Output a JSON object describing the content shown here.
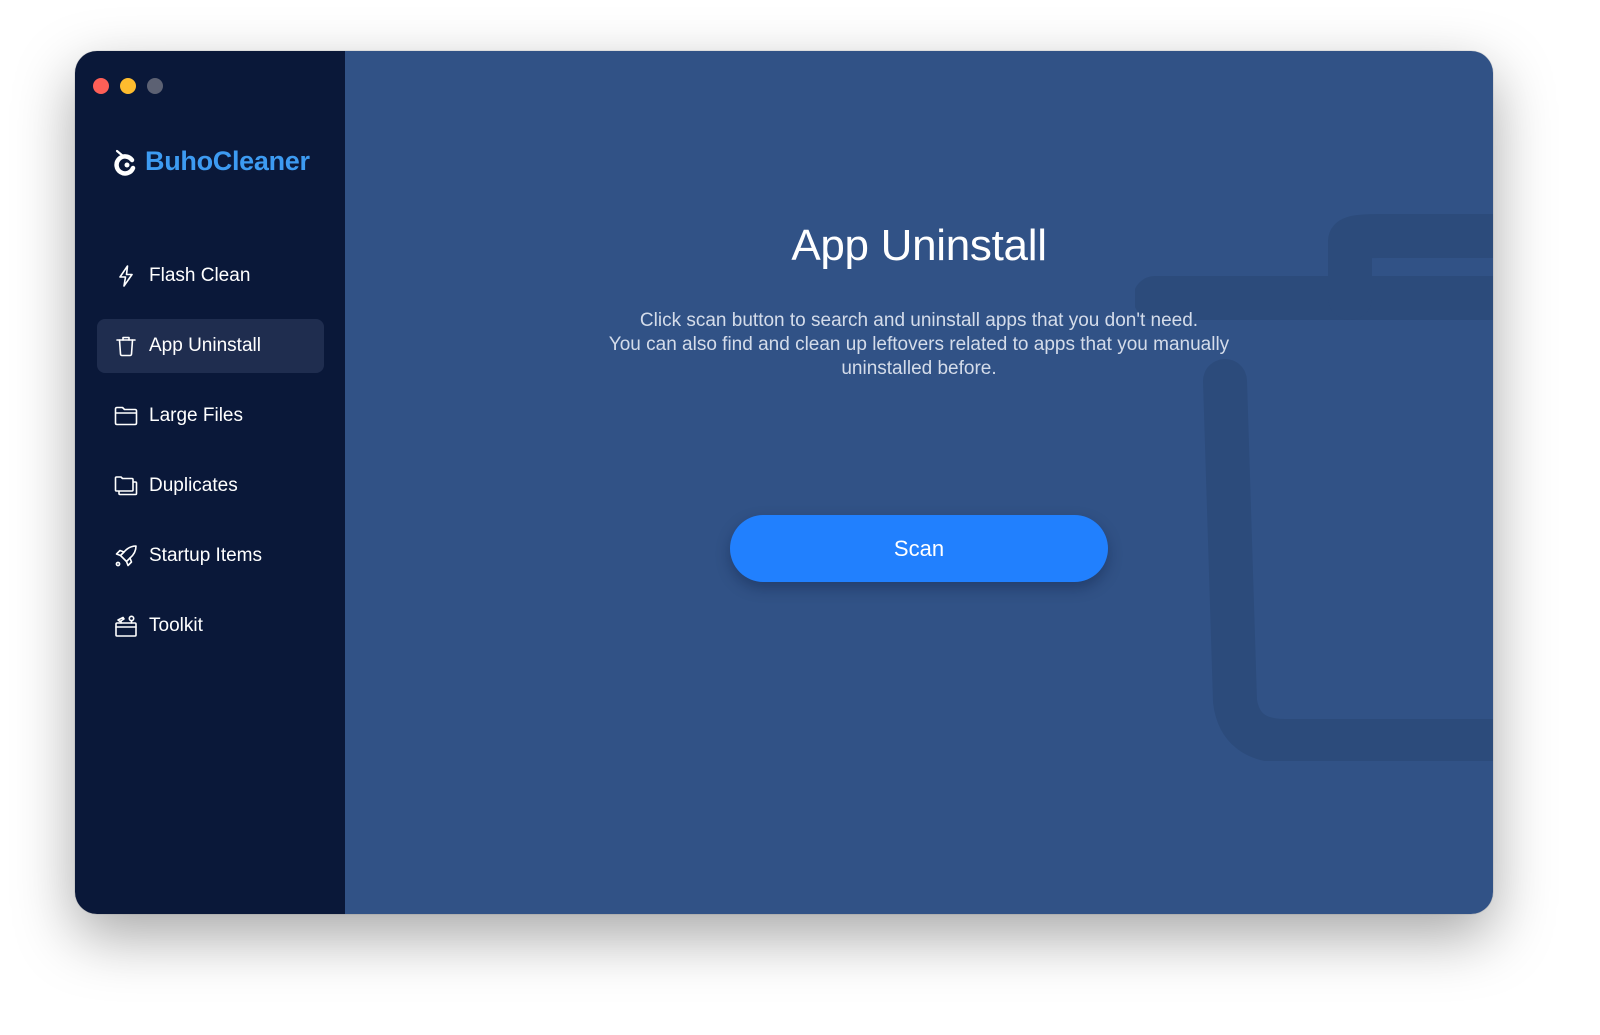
{
  "window": {
    "traffic_lights": [
      "close",
      "minimize",
      "maximize"
    ]
  },
  "brand": {
    "name": "BuhoCleaner",
    "logo_icon": "buho-owl-logo-icon",
    "color": "#3d9bf2"
  },
  "sidebar": {
    "active": "App Uninstall",
    "items": [
      {
        "label": "Flash Clean",
        "icon": "lightning-bolt-icon",
        "active": false
      },
      {
        "label": "App Uninstall",
        "icon": "trash-icon",
        "active": true
      },
      {
        "label": "Large Files",
        "icon": "folder-icon",
        "active": false
      },
      {
        "label": "Duplicates",
        "icon": "duplicate-folders-icon",
        "active": false
      },
      {
        "label": "Startup Items",
        "icon": "rocket-icon",
        "active": false
      },
      {
        "label": "Toolkit",
        "icon": "toolbox-icon",
        "active": false
      }
    ]
  },
  "main": {
    "title": "App Uninstall",
    "description": [
      "Click scan button to search and uninstall apps that you don't need.",
      "You can also find and clean up leftovers related to apps that you manually",
      "uninstalled before."
    ],
    "scan_button": "Scan",
    "background_icon": "trash-watermark-icon"
  },
  "colors": {
    "sidebar_bg": "#0a1839",
    "main_bg": "#315286",
    "accent": "#2180fe",
    "active_item_bg": "#1f2d4f"
  }
}
